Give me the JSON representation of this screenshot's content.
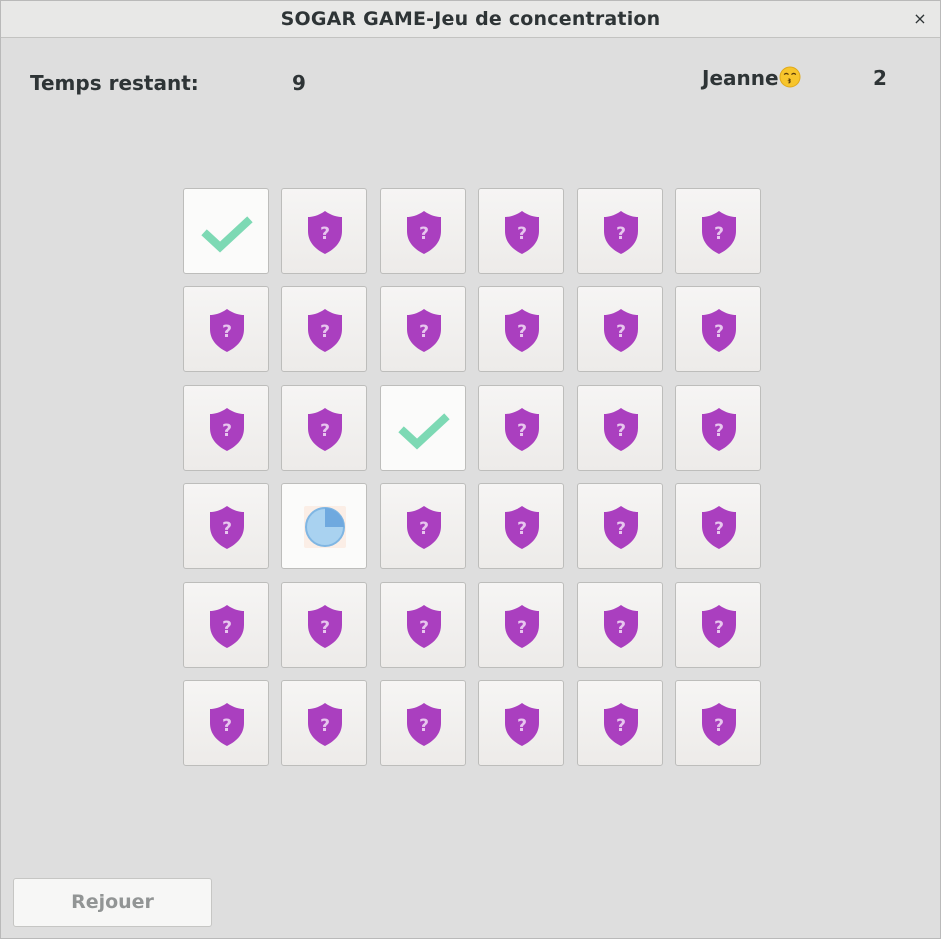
{
  "window": {
    "title": "SOGAR GAME-Jeu de concentration",
    "close_glyph": "×"
  },
  "status": {
    "time_label": "Temps restant:",
    "time_value": "9",
    "player_name": "Jeanne",
    "player_emoji": "kissing-face-emoji",
    "player_score": "2"
  },
  "board": {
    "rows": 6,
    "cols": 6,
    "cards": [
      [
        "check",
        "hidden",
        "hidden",
        "hidden",
        "hidden",
        "hidden"
      ],
      [
        "hidden",
        "hidden",
        "hidden",
        "hidden",
        "hidden",
        "hidden"
      ],
      [
        "hidden",
        "hidden",
        "check",
        "hidden",
        "hidden",
        "hidden"
      ],
      [
        "hidden",
        "pie",
        "hidden",
        "hidden",
        "hidden",
        "hidden"
      ],
      [
        "hidden",
        "hidden",
        "hidden",
        "hidden",
        "hidden",
        "hidden"
      ],
      [
        "hidden",
        "hidden",
        "hidden",
        "hidden",
        "hidden",
        "hidden"
      ]
    ],
    "icons": {
      "hidden": "shield-question-icon",
      "check": "checkmark-icon",
      "pie": "pie-chart-icon"
    },
    "colors": {
      "shield": "#aa3fbf",
      "check": "#7dd9b4",
      "pie": "#a9d2f0"
    }
  },
  "actions": {
    "replay_label": "Rejouer"
  }
}
